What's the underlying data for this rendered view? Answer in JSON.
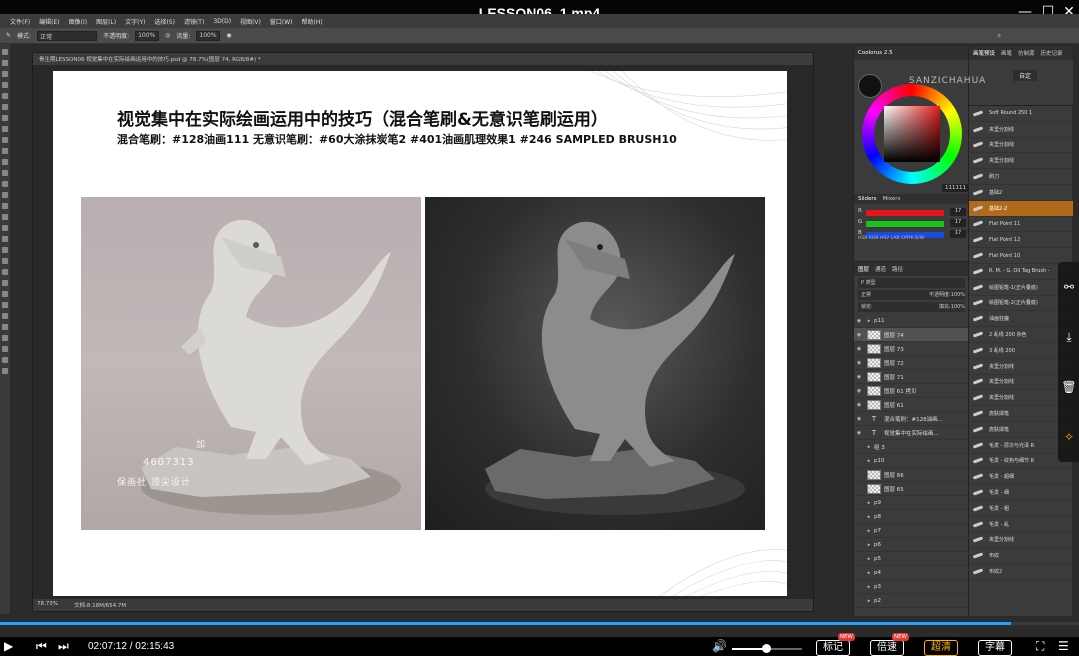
{
  "video": {
    "title": "LESSON06_1.mp4",
    "time_current": "02:07:12",
    "time_total": "02:15:43",
    "time_sep": " / ",
    "progress_fraction": 0.937,
    "volume_fraction": 0.56,
    "buttons": {
      "mark": "标记",
      "speed": "倍速",
      "quality": "超清",
      "subtitle": "字幕"
    },
    "new_badge": "NEW"
  },
  "ps": {
    "menu": [
      "文件(F)",
      "编辑(E)",
      "图像(I)",
      "图层(L)",
      "文字(Y)",
      "选择(S)",
      "滤镜(T)",
      "3D(D)",
      "视图(V)",
      "窗口(W)",
      "帮助(H)"
    ],
    "options": {
      "mode_label": "模式:",
      "mode_value": "正常",
      "opacity_label": "不透明度:",
      "opacity_value": "100%",
      "flow_label": "流量:",
      "flow_value": "100%"
    },
    "doc_tab": "骨生期LESSON06 视觉集中在实际绘画运用中的技巧.psd @ 78.7%(图层 74, RGB/8#) *",
    "status": {
      "zoom": "78.73%",
      "docsize": "文档:8.18M/654.7M"
    }
  },
  "slide": {
    "title": "视觉集中在实际绘画运用中的技巧（混合笔刷&无意识笔刷运用）",
    "subtitle": "混合笔刷：#128油画111    无意识笔刷：#60大涂抹炭笔2  #401油画肌理效果1  #246 SAMPLED BRUSH10",
    "watermark": {
      "top": "加",
      "number": "4607313",
      "bottom": "保画社   顶尖设计"
    }
  },
  "color_panel": {
    "tab": "Coolorus 2.5",
    "hex": "111111",
    "sliders_tabs": [
      "Sliders",
      "Mixers"
    ],
    "sliders": [
      {
        "label": "R",
        "value": "17",
        "color": "#e3161a"
      },
      {
        "label": "G",
        "value": "17",
        "color": "#1ac41a"
      },
      {
        "label": "B",
        "value": "17",
        "color": "#1a49e3"
      }
    ],
    "modes": "HSB RGB HSV LAB CMYK B/W"
  },
  "layers_panel": {
    "tabs": [
      "图层",
      "通道",
      "路径"
    ],
    "filter": "P 类型",
    "blend": "正常",
    "opacity_label": "不透明度:",
    "opacity_value": "100%",
    "lock_label": "锁定:",
    "fill_label": "填充:",
    "fill_value": "100%",
    "layers": [
      {
        "type": "folder",
        "name": "p11",
        "visible": true
      },
      {
        "type": "pixel",
        "name": "图层 74",
        "visible": true,
        "selected": true
      },
      {
        "type": "pixel",
        "name": "图层 73",
        "visible": true
      },
      {
        "type": "pixel",
        "name": "图层 72",
        "visible": true
      },
      {
        "type": "pixel",
        "name": "图层 71",
        "visible": true
      },
      {
        "type": "pixel",
        "name": "图层 61 拷贝",
        "visible": true
      },
      {
        "type": "pixel",
        "name": "图层 61",
        "visible": true
      },
      {
        "type": "text",
        "name": "混合笔刷：#128油画...",
        "visible": true
      },
      {
        "type": "text",
        "name": "视觉集中在实际绘画...",
        "visible": true
      },
      {
        "type": "folder",
        "name": "组 3",
        "visible": false
      },
      {
        "type": "folder",
        "name": "p10",
        "visible": false
      },
      {
        "type": "pixel",
        "name": "图层 66",
        "visible": false
      },
      {
        "type": "pixel",
        "name": "图层 65",
        "visible": false
      },
      {
        "type": "folder",
        "name": "p9",
        "visible": false
      },
      {
        "type": "folder",
        "name": "p8",
        "visible": false
      },
      {
        "type": "folder",
        "name": "p7",
        "visible": false
      },
      {
        "type": "folder",
        "name": "p6",
        "visible": false
      },
      {
        "type": "folder",
        "name": "p5",
        "visible": false
      },
      {
        "type": "folder",
        "name": "p4",
        "visible": false
      },
      {
        "type": "folder",
        "name": "p3",
        "visible": false
      },
      {
        "type": "folder",
        "name": "p2",
        "visible": false
      }
    ]
  },
  "brush_panel": {
    "tabs": [
      "画笔预设",
      "画笔",
      "仿制源",
      "历史记录"
    ],
    "preset_button": "自定",
    "watermark": "SANZICHAHUA",
    "items": [
      {
        "name": "Soft Round 250 1"
      },
      {
        "name": "夹里分割线"
      },
      {
        "name": "夹里分割线"
      },
      {
        "name": "夹里分割线"
      },
      {
        "name": "刷刀"
      },
      {
        "name": "基础2"
      },
      {
        "name": "基础2-2",
        "selected": true
      },
      {
        "name": "Flat Point 11"
      },
      {
        "name": "Flat Point 12"
      },
      {
        "name": "Flat Point 10"
      },
      {
        "name": "R. M. - G. Oil Tag Brush -"
      },
      {
        "name": "绘图铅笔-1(正片叠底)"
      },
      {
        "name": "绘图铅笔-2(正片叠底)"
      },
      {
        "name": "油画狂魔"
      },
      {
        "name": "2 乱线 200 杂色"
      },
      {
        "name": "3 乱线 200"
      },
      {
        "name": "夹里分割线"
      },
      {
        "name": "夹里分割线"
      },
      {
        "name": "夹里分割线"
      },
      {
        "name": "皮肤揉笔"
      },
      {
        "name": "皮肤揉笔"
      },
      {
        "name": "毛发 - 层次与光泽 R"
      },
      {
        "name": "毛发 - 纹构与细节 R"
      },
      {
        "name": "毛发 - 超细"
      },
      {
        "name": "毛发 - 细"
      },
      {
        "name": "毛发 - 粗"
      },
      {
        "name": "毛发 - 乱"
      },
      {
        "name": "夹里分割线"
      },
      {
        "name": "布纹"
      },
      {
        "name": "布纹2"
      }
    ]
  },
  "colors": {
    "ps_bg": "#2b2b2b",
    "panel": "#3b3b3b",
    "brush_selected": "#b06a1a",
    "progress": "#26a3ff",
    "gold": "#ffb300"
  }
}
